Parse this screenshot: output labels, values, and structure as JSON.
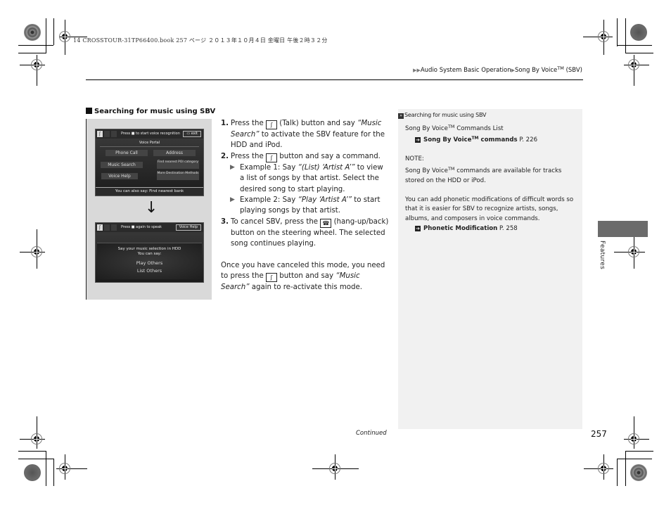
{
  "print_header": "14 CROSSTOUR-31TP66400.book  257 ページ  ２０１３年１０月４日  金曜日  午後２時３２分",
  "breadcrumb": {
    "items": [
      "Audio System Basic Operation",
      "Song By Voice",
      "(SBV)"
    ],
    "tm": "TM"
  },
  "section": {
    "heading": "Searching for music using SBV"
  },
  "figure": {
    "screen1": {
      "message": "Press ■ to start voice recognition",
      "button": "exit",
      "title": "Voice Portal",
      "options": [
        "Phone Call",
        "Address",
        "Music Search",
        "Find nearest POI category",
        "Voice Help",
        "More Destination Methods"
      ],
      "footer": "You can also say: Find nearest bank"
    },
    "arrow": "↓",
    "screen2": {
      "message": "Press ■ again to speak",
      "button": "Voice Help",
      "line1": "Say your music selection in HDD",
      "line2": "You can say:",
      "commands": [
        "Play Others",
        "List Others"
      ]
    }
  },
  "steps": [
    {
      "num": "1.",
      "pre": "Press the",
      "icon": "talk-button",
      "mid": "(Talk) button and say",
      "quote": "“Music Search”",
      "post": "to activate the SBV feature for the HDD and iPod."
    },
    {
      "num": "2.",
      "pre": "Press the",
      "icon": "talk-button",
      "post": "button and say a command.",
      "examples": [
        {
          "pre": "Example 1: Say",
          "quote": "“(List) ‘Artist A’”",
          "post": "to view a list of songs by that artist. Select the desired song to start playing."
        },
        {
          "pre": "Example 2: Say",
          "quote": "“Play ‘Artist A’”",
          "post": "to start playing songs by that artist."
        }
      ]
    },
    {
      "num": "3.",
      "pre": "To cancel SBV, press the",
      "icon": "hang-up-back-button",
      "post": "(hang-up/back) button on the steering wheel. The selected song continues playing."
    }
  ],
  "closing_paragraph": {
    "pre": "Once you have canceled this mode, you need to press the",
    "icon": "talk-button",
    "mid": "button and say",
    "quote": "“Music Search”",
    "post": "again to re-activate this mode."
  },
  "sidebar": {
    "title": "Searching for music using SBV",
    "commands_list_label": "Song By Voice",
    "commands_list_suffix": "Commands List",
    "ref1": {
      "label": "Song By Voice",
      "label_suffix": "commands",
      "page": "P. 226"
    },
    "note_label": "NOTE:",
    "note_text_pre": "Song By Voice",
    "note_text_post": "commands are available for tracks stored on the HDD or iPod.",
    "phonetic_text": "You can add phonetic modifications of difficult words so that it is easier for SBV to recognize artists, songs, albums, and composers in voice commands.",
    "ref2": {
      "label": "Phonetic Modification",
      "page": "P. 258"
    },
    "tm": "TM"
  },
  "chapter_tab": {
    "label": "Features",
    "color": "#6b6b6b"
  },
  "footer": {
    "continued": "Continued",
    "page_number": "257"
  }
}
